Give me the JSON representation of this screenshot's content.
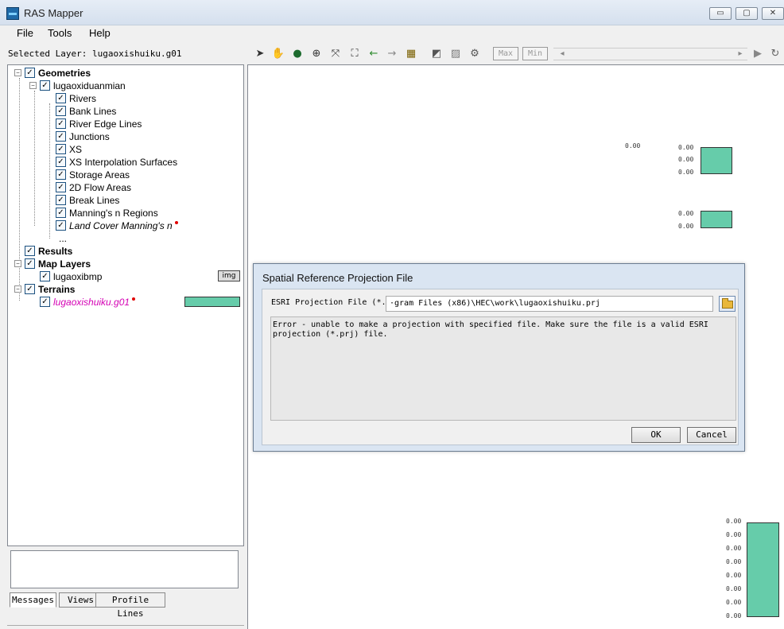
{
  "window": {
    "title": "RAS Mapper",
    "minimize": "▭",
    "maximize": "▢",
    "close": "✕"
  },
  "menu": [
    "File",
    "Tools",
    "Help"
  ],
  "selected_layer_text": "Selected Layer: lugaoxishuiku.g01",
  "toolbar": {
    "max_label": "Max",
    "min_label": "Min"
  },
  "tree": {
    "geometries": "Geometries",
    "geometry_name": "lugaoxiduanmian",
    "geometry_layers": [
      "Rivers",
      "Bank Lines",
      "River Edge Lines",
      "Junctions",
      "XS",
      "XS Interpolation Surfaces",
      "Storage Areas",
      "2D Flow Areas",
      "Break Lines",
      "Manning's n Regions",
      "Land Cover Manning's n"
    ],
    "more": "...",
    "results": "Results",
    "map_layers": "Map Layers",
    "map_layer_item": "lugaoxibmp",
    "img_badge": "img",
    "terrains": "Terrains",
    "terrain_item": "lugaoxishuiku.g01",
    "terrain_color": "#66ccaa"
  },
  "tabs": [
    "Messages",
    "Views",
    "Profile Lines"
  ],
  "legend": {
    "top_labels": [
      "0.00",
      "0.00",
      "0.00",
      "0.00"
    ],
    "mid_labels": [
      "0.00",
      "0.00"
    ],
    "bottom_labels": [
      "0.00",
      "0.00",
      "0.00",
      "0.00",
      "0.00",
      "0.00",
      "0.00",
      "0.00"
    ]
  },
  "dialog": {
    "title": "Spatial Reference Projection File",
    "prj_label": "ESRI Projection File (*.prj):",
    "prj_value": "·gram Files (x86)\\HEC\\work\\lugaoxishuiku.prj",
    "error_text": "Error - unable to make a projection with specified file. Make sure the file is a valid ESRI\nprojection (*.prj) file.",
    "ok": "OK",
    "cancel": "Cancel"
  },
  "colors": {
    "accent_teal": "#66ccaa",
    "terrain_text": "#d400b4"
  }
}
